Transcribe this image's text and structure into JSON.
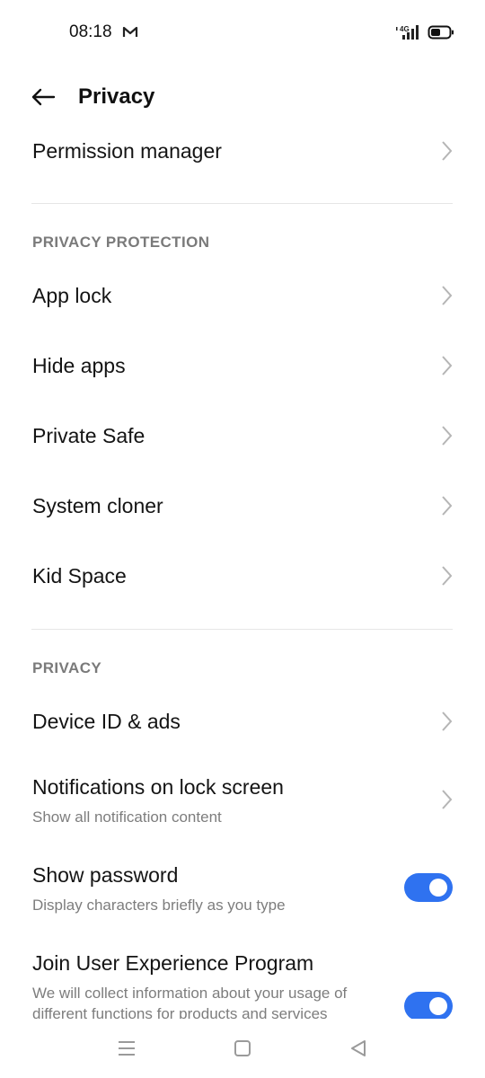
{
  "status_bar": {
    "time": "08:18",
    "mail_icon": "gmail-icon",
    "signal_icon": "4g-signal-icon",
    "network_label": "4G",
    "battery_icon": "battery-icon",
    "battery_level": 0.5
  },
  "header": {
    "title": "Privacy",
    "back_icon": "arrow-left-icon"
  },
  "rows_top": [
    {
      "title": "Permission manager"
    }
  ],
  "sections": [
    {
      "header": "PRIVACY PROTECTION",
      "items": [
        {
          "title": "App lock"
        },
        {
          "title": "Hide apps"
        },
        {
          "title": "Private Safe"
        },
        {
          "title": "System cloner"
        },
        {
          "title": "Kid Space"
        }
      ]
    },
    {
      "header": "PRIVACY",
      "items": [
        {
          "title": "Device ID & ads"
        },
        {
          "title": "Notifications on lock screen",
          "subtitle": "Show all notification content"
        },
        {
          "title": "Show password",
          "subtitle": "Display characters briefly as you type",
          "toggle": true
        },
        {
          "title": "Join User Experience Program",
          "subtitle_line1": "We will collect information about your usage of",
          "subtitle_line2": "different functions for products and services",
          "toggle": true
        }
      ]
    }
  ],
  "colors": {
    "accent": "#2f72f0",
    "text": "#141414",
    "secondary_text": "#7d7d7d",
    "section_header": "#7a7a7a",
    "divider": "#e6e6e6"
  },
  "nav_bar": {
    "menu_icon": "recent-apps-icon",
    "home_icon": "home-square-icon",
    "back_icon": "back-triangle-icon"
  }
}
